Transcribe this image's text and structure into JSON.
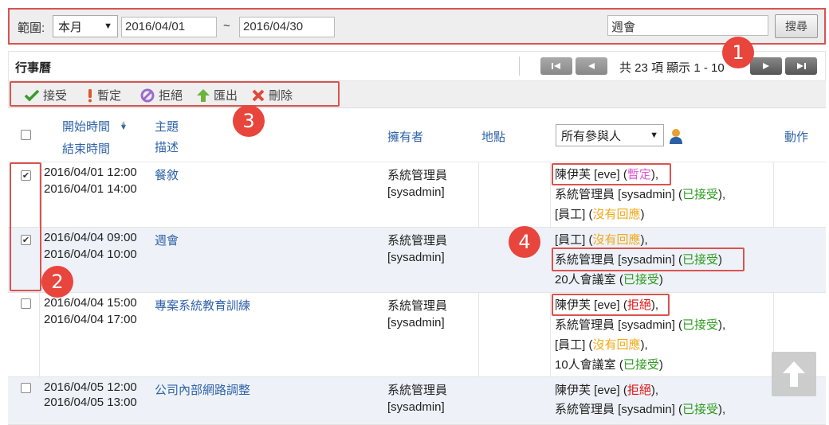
{
  "search": {
    "range_label": "範圍:",
    "range_value": "本月",
    "date_from": "2016/04/01",
    "tilde": "~",
    "date_to": "2016/04/30",
    "keyword": "週會",
    "search_button": "搜尋"
  },
  "calendar": {
    "title": "行事曆",
    "pager_text": "共 23 項 顯示 1 - 10"
  },
  "toolbar": {
    "accept": "接受",
    "tentative": "暫定",
    "reject": "拒絕",
    "export": "匯出",
    "delete": "刪除"
  },
  "columns": {
    "start_time": "開始時間",
    "end_time": "結束時間",
    "subject": "主題",
    "description": "描述",
    "owner": "擁有者",
    "location": "地點",
    "participants_filter": "所有參與人",
    "actions": "動作"
  },
  "rows": [
    {
      "start": "2016/04/01 12:00",
      "end": "2016/04/01 14:00",
      "subject": "餐敘",
      "owner1": "系統管理員",
      "owner2": "[sysadmin]",
      "p": [
        {
          "name": "陳伊芙 [eve] (",
          "status": "暫定",
          "tail": "),"
        },
        {
          "name": "系統管理員 [sysadmin] (",
          "status": "已接受",
          "tail": "),"
        },
        {
          "name": "[員工] (",
          "status": "沒有回應",
          "tail": ")"
        }
      ]
    },
    {
      "start": "2016/04/04 09:00",
      "end": "2016/04/04 10:00",
      "subject": "週會",
      "owner1": "系統管理員",
      "owner2": "[sysadmin]",
      "p": [
        {
          "name": "[員工] (",
          "status": "沒有回應",
          "tail": "),"
        },
        {
          "name": "系統管理員 [sysadmin] (",
          "status": "已接受",
          "tail": ")"
        },
        {
          "name": "20人會議室 (",
          "status": "已接受",
          "tail": ")"
        }
      ]
    },
    {
      "start": "2016/04/04 15:00",
      "end": "2016/04/04 17:00",
      "subject": "專案系統教育訓練",
      "owner1": "系統管理員",
      "owner2": "[sysadmin]",
      "p": [
        {
          "name": "陳伊芙 [eve] (",
          "status": "拒絕",
          "tail": "),"
        },
        {
          "name": "系統管理員 [sysadmin] (",
          "status": "已接受",
          "tail": "),"
        },
        {
          "name": "[員工] (",
          "status": "沒有回應",
          "tail": "),"
        },
        {
          "name": "10人會議室 (",
          "status": "已接受",
          "tail": ")"
        }
      ]
    },
    {
      "start": "2016/04/05 12:00",
      "end": "2016/04/05 13:00",
      "subject": "公司內部網路調整",
      "owner1": "系統管理員",
      "owner2": "[sysadmin]",
      "p": [
        {
          "name": "陳伊芙 [eve] (",
          "status": "拒絕",
          "tail": "),"
        },
        {
          "name": "系統管理員 [sysadmin] (",
          "status": "已接受",
          "tail": "),"
        }
      ]
    }
  ],
  "annotations": [
    "1",
    "2",
    "3",
    "4"
  ],
  "colors": {
    "highlight": "#d9534f",
    "link": "#2f63a8",
    "tentative": "#e05ad0",
    "accepted": "#2e9b20",
    "no_response": "#f0a818",
    "rejected": "#e01010"
  }
}
